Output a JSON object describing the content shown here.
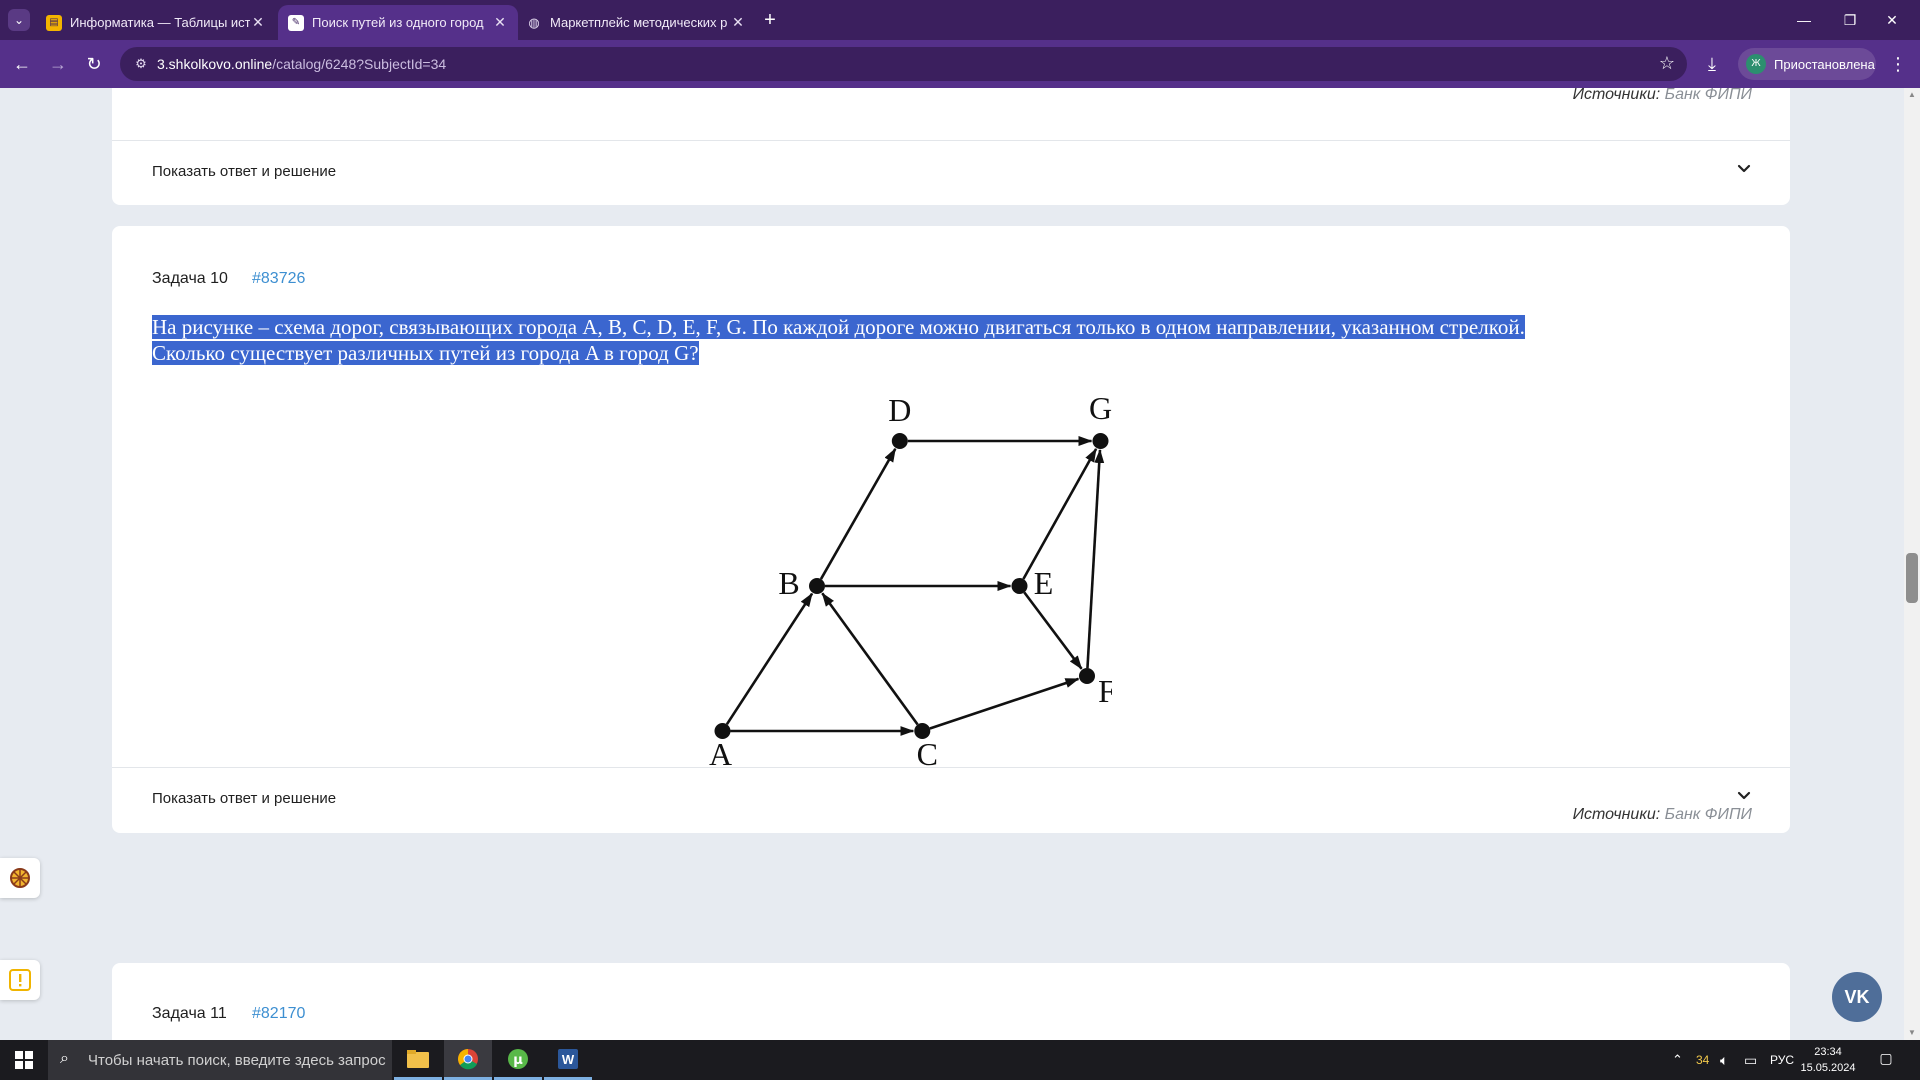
{
  "browser": {
    "tabs": [
      {
        "title": "Информатика — Таблицы ист",
        "favicon": "slides-icon",
        "active": false
      },
      {
        "title": "Поиск путей из одного город",
        "favicon": "pencil-icon",
        "active": true
      },
      {
        "title": "Маркетплейс методических р",
        "favicon": "globe-icon",
        "active": false
      }
    ],
    "url_host": "3.shkolkovo.online",
    "url_path": "/catalog/6248?SubjectId=34",
    "profile_initial": "Ж",
    "profile_label": "Приостановлена"
  },
  "page": {
    "prev_card": {
      "source_label": "Источники:",
      "source_link": "Банк ФИПИ",
      "toggle_label": "Показать ответ и решение"
    },
    "task": {
      "heading": "Задача 10",
      "id": "#83726",
      "text_line1": "На рисунке – схема дорог, связывающих города A, B, C, D, E, F, G. По каждой дороге можно двигаться только в одном направлении, указанном стрелкой.",
      "text_line2": "Сколько существует различных путей из города A в город G?",
      "graph": {
        "nodes": [
          "A",
          "B",
          "C",
          "D",
          "E",
          "F",
          "G"
        ],
        "edges": [
          [
            "A",
            "B"
          ],
          [
            "A",
            "C"
          ],
          [
            "C",
            "B"
          ],
          [
            "B",
            "D"
          ],
          [
            "B",
            "E"
          ],
          [
            "C",
            "F"
          ],
          [
            "D",
            "G"
          ],
          [
            "E",
            "G"
          ],
          [
            "E",
            "F"
          ],
          [
            "F",
            "G"
          ]
        ]
      },
      "source_label": "Источники:",
      "source_link": "Банк ФИПИ",
      "toggle_label": "Показать ответ и решение"
    },
    "next_task": {
      "heading": "Задача 11",
      "id": "#82170"
    },
    "vk_label": "VK"
  },
  "taskbar": {
    "search_placeholder": "Чтобы начать поиск, введите здесь запрос",
    "tray_count": "34",
    "language": "РУС",
    "time": "23:34",
    "date": "15.05.2024"
  },
  "colors": {
    "tab_strip": "#3b1f5e",
    "toolbar": "#55308a",
    "selection": "#3b66cf",
    "task_id_link": "#3d8fd1"
  }
}
